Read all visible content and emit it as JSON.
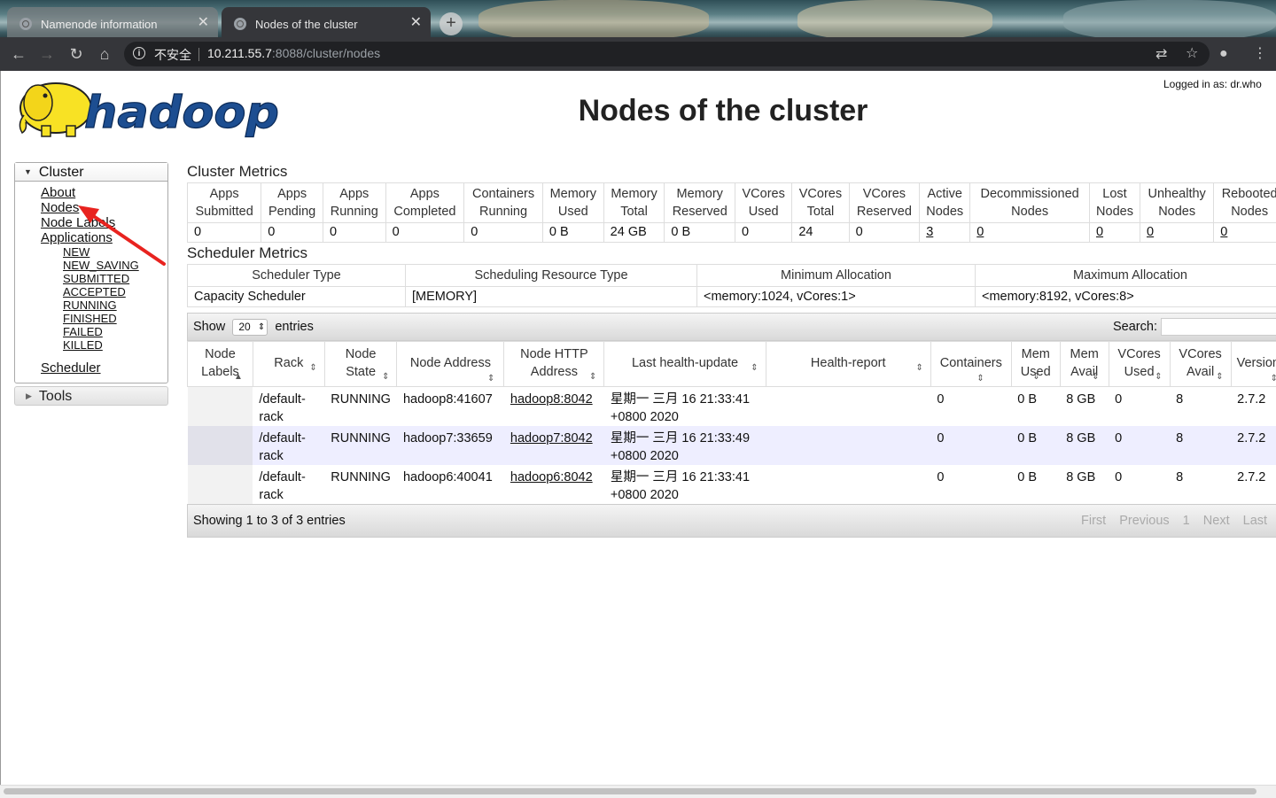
{
  "browser": {
    "tabs": [
      {
        "title": "Namenode information",
        "active": false
      },
      {
        "title": "Nodes of the cluster",
        "active": true
      }
    ],
    "security_label": "不安全",
    "url_host": "10.211.55.7",
    "url_path": ":8088/cluster/nodes"
  },
  "page": {
    "logged_in": "Logged in as: dr.who",
    "title": "Nodes of the cluster"
  },
  "sidebar": {
    "cluster_label": "Cluster",
    "links": [
      "About",
      "Nodes",
      "Node Labels",
      "Applications"
    ],
    "app_states": [
      "NEW",
      "NEW_SAVING",
      "SUBMITTED",
      "ACCEPTED",
      "RUNNING",
      "FINISHED",
      "FAILED",
      "KILLED"
    ],
    "scheduler": "Scheduler",
    "tools_label": "Tools"
  },
  "cluster_metrics": {
    "title": "Cluster Metrics",
    "headers": [
      [
        "Apps",
        "Submitted"
      ],
      [
        "Apps",
        "Pending"
      ],
      [
        "Apps",
        "Running"
      ],
      [
        "Apps",
        "Completed"
      ],
      [
        "Containers",
        "Running"
      ],
      [
        "Memory",
        "Used"
      ],
      [
        "Memory",
        "Total"
      ],
      [
        "Memory",
        "Reserved"
      ],
      [
        "VCores",
        "Used"
      ],
      [
        "VCores",
        "Total"
      ],
      [
        "VCores",
        "Reserved"
      ],
      [
        "Active",
        "Nodes"
      ],
      [
        "Decommissioned",
        "Nodes"
      ],
      [
        "Lost",
        "Nodes"
      ],
      [
        "Unhealthy",
        "Nodes"
      ],
      [
        "Rebooted",
        "Nodes"
      ]
    ],
    "values": [
      "0",
      "0",
      "0",
      "0",
      "0",
      "0 B",
      "24 GB",
      "0 B",
      "0",
      "24",
      "0",
      "3",
      "0",
      "0",
      "0",
      "0"
    ]
  },
  "scheduler_metrics": {
    "title": "Scheduler Metrics",
    "headers": [
      "Scheduler Type",
      "Scheduling Resource Type",
      "Minimum Allocation",
      "Maximum Allocation"
    ],
    "values": [
      "Capacity Scheduler",
      "[MEMORY]",
      "<memory:1024, vCores:1>",
      "<memory:8192, vCores:8>"
    ]
  },
  "nodes_table": {
    "show_label": "Show",
    "entries_value": "20",
    "entries_label": "entries",
    "search_label": "Search:",
    "headers": [
      [
        "Node",
        "Labels"
      ],
      [
        "Rack"
      ],
      [
        "Node",
        "State"
      ],
      [
        "Node Address"
      ],
      [
        "Node HTTP",
        "Address"
      ],
      [
        "Last health-update"
      ],
      [
        "Health-report"
      ],
      [
        "Containers"
      ],
      [
        "Mem",
        "Used"
      ],
      [
        "Mem",
        "Avail"
      ],
      [
        "VCores",
        "Used"
      ],
      [
        "VCores",
        "Avail"
      ],
      [
        "Version"
      ]
    ],
    "rows": [
      [
        "",
        "/default-rack",
        "RUNNING",
        "hadoop8:41607",
        "hadoop8:8042",
        "星期一 三月 16 21:33:41 +0800 2020",
        "",
        "0",
        "0 B",
        "8 GB",
        "0",
        "8",
        "2.7.2"
      ],
      [
        "",
        "/default-rack",
        "RUNNING",
        "hadoop7:33659",
        "hadoop7:8042",
        "星期一 三月 16 21:33:49 +0800 2020",
        "",
        "0",
        "0 B",
        "8 GB",
        "0",
        "8",
        "2.7.2"
      ],
      [
        "",
        "/default-rack",
        "RUNNING",
        "hadoop6:40041",
        "hadoop6:8042",
        "星期一 三月 16 21:33:41 +0800 2020",
        "",
        "0",
        "0 B",
        "8 GB",
        "0",
        "8",
        "2.7.2"
      ]
    ],
    "info": "Showing 1 to 3 of 3 entries",
    "pager": [
      "First",
      "Previous",
      "1",
      "Next",
      "Last"
    ]
  },
  "colors": {
    "logo_yellow": "#f8e224",
    "logo_blue": "#1d4e91",
    "annotation_arrow": "#e8231f"
  }
}
